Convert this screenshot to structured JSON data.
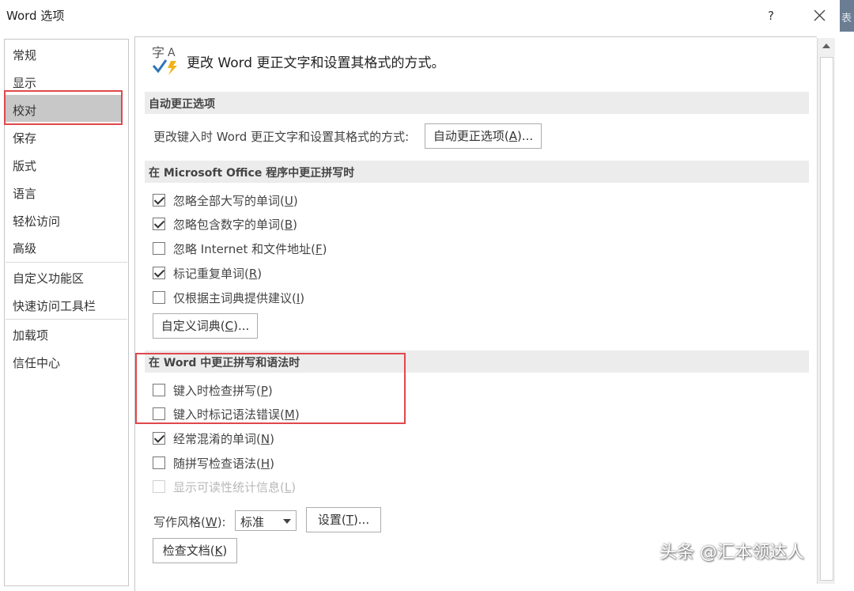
{
  "window": {
    "title": "Word 选项",
    "help": "?"
  },
  "edge_text": "表",
  "sidebar": {
    "items": [
      {
        "label": "常规"
      },
      {
        "label": "显示"
      },
      {
        "label": "校对"
      },
      {
        "label": "保存"
      },
      {
        "label": "版式"
      },
      {
        "label": "语言"
      },
      {
        "label": "轻松访问"
      },
      {
        "label": "高级"
      },
      {
        "label": "自定义功能区"
      },
      {
        "label": "快速访问工具栏"
      },
      {
        "label": "加载项"
      },
      {
        "label": "信任中心"
      }
    ],
    "selected": "校对"
  },
  "main": {
    "header": "更改 Word 更正文字和设置其格式的方式。",
    "autocorrect": {
      "title": "自动更正选项",
      "label": "更改键入时 Word 更正文字和设置其格式的方式:",
      "button_pre": "自动更正选项(",
      "button_key": "A",
      "button_post": ")..."
    },
    "office": {
      "title": "在 Microsoft Office 程序中更正拼写时",
      "checkboxes": [
        {
          "pre": "忽略全部大写的单词(",
          "key": "U",
          "post": ")",
          "checked": true
        },
        {
          "pre": "忽略包含数字的单词(",
          "key": "B",
          "post": ")",
          "checked": true
        },
        {
          "pre": "忽略 Internet 和文件地址(",
          "key": "F",
          "post": ")",
          "checked": false
        },
        {
          "pre": "标记重复单词(",
          "key": "R",
          "post": ")",
          "checked": true
        },
        {
          "pre": "仅根据主词典提供建议(",
          "key": "I",
          "post": ")",
          "checked": false
        }
      ],
      "dict_button_pre": "自定义词典(",
      "dict_button_key": "C",
      "dict_button_post": ")..."
    },
    "word": {
      "title": "在 Word 中更正拼写和语法时",
      "checkboxes": [
        {
          "pre": "键入时检查拼写(",
          "key": "P",
          "post": ")",
          "checked": false,
          "disabled": false
        },
        {
          "pre": "键入时标记语法错误(",
          "key": "M",
          "post": ")",
          "checked": false,
          "disabled": false
        },
        {
          "pre": "经常混淆的单词(",
          "key": "N",
          "post": ")",
          "checked": true,
          "disabled": false
        },
        {
          "pre": "随拼写检查语法(",
          "key": "H",
          "post": ")",
          "checked": false,
          "disabled": false
        },
        {
          "pre": "显示可读性统计信息(",
          "key": "L",
          "post": ")",
          "checked": false,
          "disabled": true
        }
      ],
      "style_label_pre": "写作风格(",
      "style_label_key": "W",
      "style_label_post": "):",
      "style_value": "标准",
      "settings_pre": "设置(",
      "settings_key": "T",
      "settings_post": ")...",
      "check_pre": "检查文档(",
      "check_key": "K",
      "check_post": ")"
    }
  },
  "watermark": "头条 @汇本领达人",
  "colors": {
    "highlight_border": "#e0474c",
    "section_bg": "#ececec",
    "selected_bg": "#c8c8c8"
  }
}
